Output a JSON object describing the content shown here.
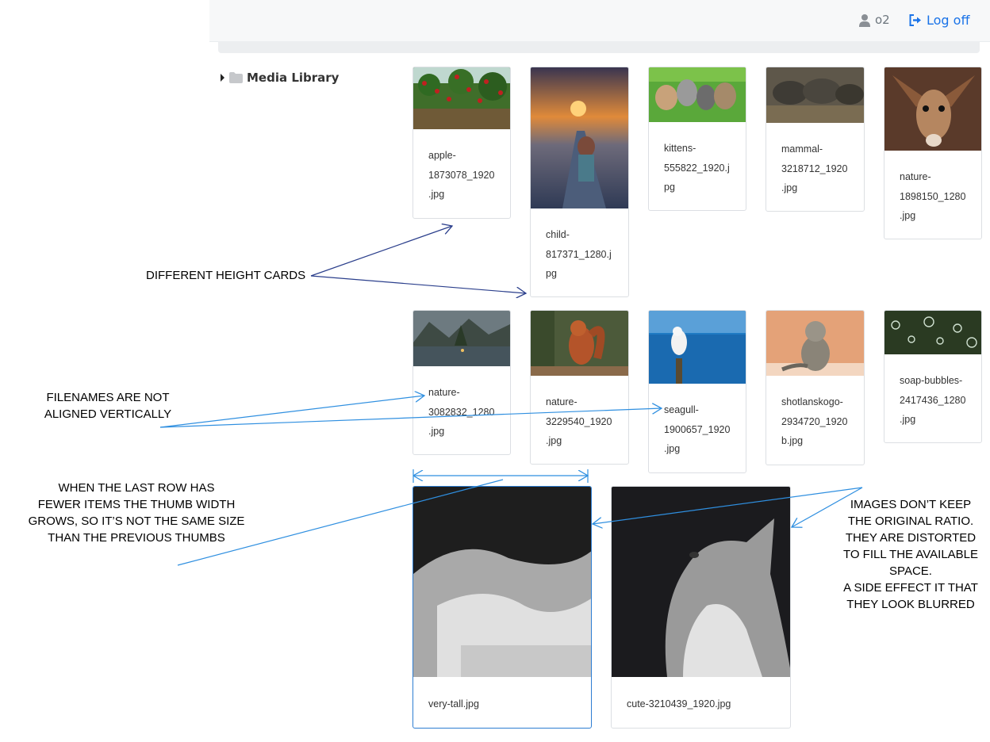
{
  "header": {
    "username": "o2",
    "logoff_label": "Log off"
  },
  "tree": {
    "root_label": "Media Library"
  },
  "files": [
    {
      "name": "apple-1873078_1920.jpg",
      "lines": [
        "apple-",
        "1873078_1920",
        ".jpg"
      ]
    },
    {
      "name": "child-817371_1280.jpg",
      "lines": [
        "child-",
        "817371_1280.j",
        "pg"
      ]
    },
    {
      "name": "kittens-555822_1920.jpg",
      "lines": [
        "kittens-",
        "555822_1920.j",
        "pg"
      ]
    },
    {
      "name": "mammal-3218712_1920.jpg",
      "lines": [
        "mammal-",
        "3218712_1920",
        ".jpg"
      ]
    },
    {
      "name": "nature-1898150_1280.jpg",
      "lines": [
        "nature-",
        "1898150_1280",
        ".jpg"
      ]
    },
    {
      "name": "nature-3082832_1280.jpg",
      "lines": [
        "nature-",
        "3082832_1280",
        ".jpg"
      ]
    },
    {
      "name": "nature-3229540_1920.jpg",
      "lines": [
        "nature-",
        "3229540_1920",
        ".jpg"
      ]
    },
    {
      "name": "seagull-1900657_1920.jpg",
      "lines": [
        "seagull-",
        "1900657_1920",
        ".jpg"
      ]
    },
    {
      "name": "shotlanskogo-2934720_1920b.jpg",
      "lines": [
        "shotlanskogo-",
        "2934720_1920",
        "b.jpg"
      ]
    },
    {
      "name": "soap-bubbles-2417436_1280.jpg",
      "lines": [
        "soap-bubbles-",
        "2417436_1280",
        ".jpg"
      ]
    },
    {
      "name": "very-tall.jpg",
      "lines": [
        "very-tall.jpg"
      ]
    },
    {
      "name": "cute-3210439_1920.jpg",
      "lines": [
        "cute-3210439_1920.jpg"
      ]
    }
  ],
  "annotations": {
    "different_height": "DIFFERENT HEIGHT CARDS",
    "filenames_line1": "FILENAMES ARE NOT",
    "filenames_line2": "ALIGNED VERTICALLY",
    "last_row": "WHEN THE LAST ROW HAS\nFEWER ITEMS THE THUMB WIDTH\nGROWS, SO IT’S NOT THE SAME SIZE\nTHAN THE PREVIOUS THUMBS",
    "ratio": "IMAGES DON’T KEEP\nTHE ORIGINAL RATIO.\nTHEY ARE DISTORTED\nTO FILL THE AVAILABLE\nSPACE.\nA SIDE EFFECT IT THAT\nTHEY LOOK BLURRED"
  },
  "colors": {
    "link": "#1a73e8",
    "annotation_dark": "#2b3f8c",
    "annotation_light": "#2f8fe0"
  }
}
